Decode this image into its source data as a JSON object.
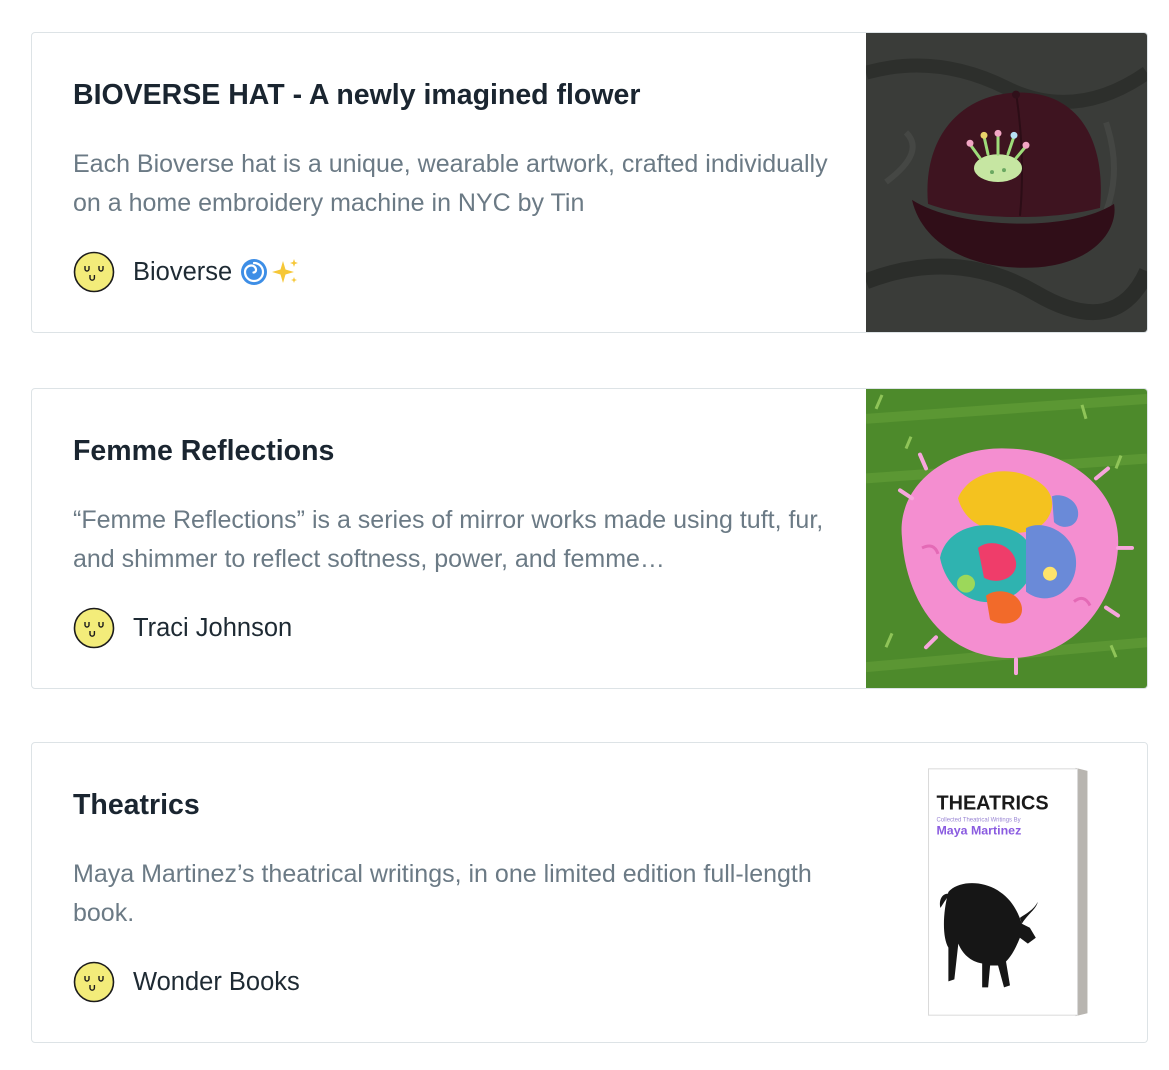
{
  "cards": [
    {
      "title": "BIOVERSE HAT - A newly imagined flower",
      "description": "Each Bioverse hat is a unique, wearable artwork, crafted individually on a home embroidery machine in NYC by Tin",
      "author": "Bioverse",
      "author_emoji": [
        "cyclone-icon",
        "sparkles-icon"
      ],
      "image": "burgundy-cap-photo"
    },
    {
      "title": "Femme Reflections",
      "description": "“Femme Reflections” is a series of mirror works made using tuft, fur, and shimmer to reflect softness, power, and femme…",
      "author": "Traci Johnson",
      "image": "pink-fur-mirror-photo"
    },
    {
      "title": "Theatrics",
      "description": "Maya Martinez’s theatrical writings, in one limited edition full-length book.",
      "author": "Wonder Books",
      "image": "book-cover",
      "book_cover": {
        "title": "THEATRICS",
        "subtitle": "Collected Theatrical Writings By",
        "author": "Maya Martinez"
      }
    }
  ],
  "colors": {
    "title": "#1a2530",
    "description": "#6b7a85",
    "border": "#dde3e6",
    "avatar": "#f3ec7a",
    "book_accent": "#8a5be0"
  }
}
